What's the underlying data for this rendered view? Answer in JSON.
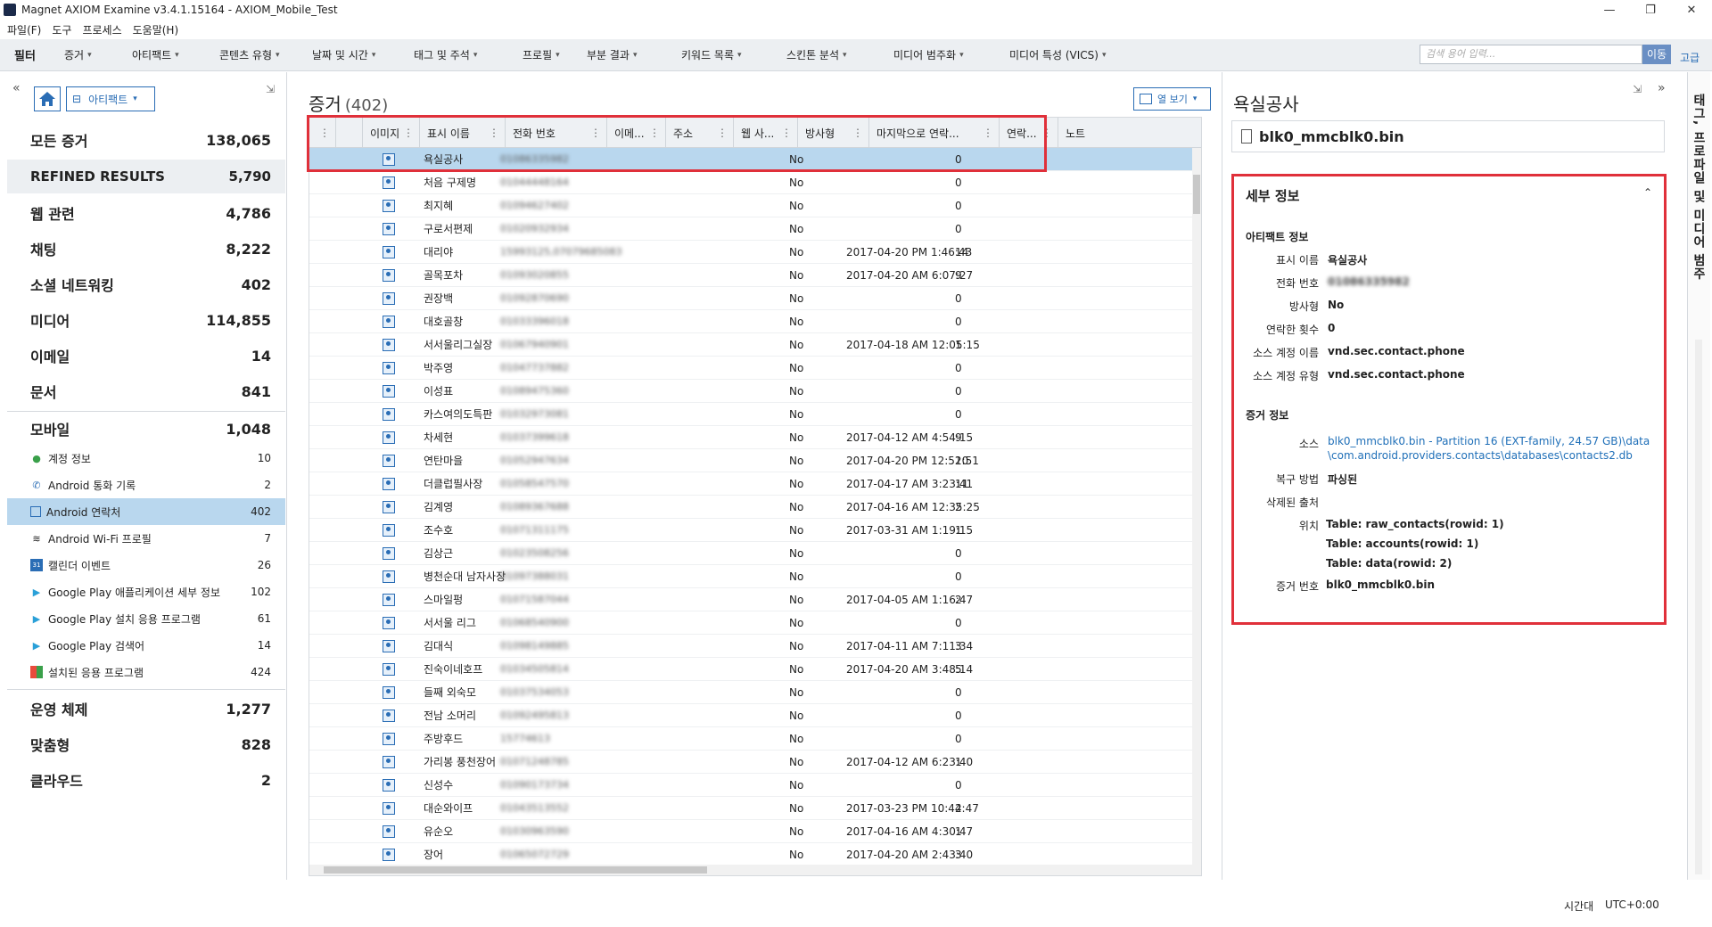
{
  "window": {
    "title": "Magnet AXIOM Examine v3.4.1.15164 - AXIOM_Mobile_Test",
    "controls": [
      "—",
      "❐",
      "✕"
    ]
  },
  "menu": [
    "파일(F)",
    "도구",
    "프로세스",
    "도움말(H)"
  ],
  "filterbar": {
    "label": "필터",
    "items": [
      "증거",
      "아티팩트",
      "콘텐츠 유형",
      "날짜 및 시간",
      "태그 및 주석",
      "프로필",
      "부분 결과",
      "키워드 목록",
      "스킨톤 분석",
      "미디어 범주화",
      "미디어 특성 (VICS)"
    ],
    "search_placeholder": "검색 용어 입력...",
    "search_button": "이동",
    "advanced": "고급"
  },
  "left": {
    "view_dropdown": "아티팩트",
    "categories": [
      {
        "label": "모든 증거",
        "count": "138,065"
      },
      {
        "label": "REFINED RESULTS",
        "count": "5,790"
      },
      {
        "label": "웹 관련",
        "count": "4,786"
      },
      {
        "label": "채팅",
        "count": "8,222"
      },
      {
        "label": "소셜 네트워킹",
        "count": "402"
      },
      {
        "label": "미디어",
        "count": "114,855"
      },
      {
        "label": "이메일",
        "count": "14"
      },
      {
        "label": "문서",
        "count": "841"
      },
      {
        "label": "모바일",
        "count": "1,048"
      }
    ],
    "mobile_items": [
      {
        "label": "계정 정보",
        "count": "10",
        "icon": "account-icon"
      },
      {
        "label": "Android 통화 기록",
        "count": "2",
        "icon": "phone-icon"
      },
      {
        "label": "Android 연락처",
        "count": "402",
        "icon": "contact-icon"
      },
      {
        "label": "Android Wi-Fi 프로필",
        "count": "7",
        "icon": "wifi-icon"
      },
      {
        "label": "캘린더 이벤트",
        "count": "26",
        "icon": "calendar-icon"
      },
      {
        "label": "Google Play 애플리케이션 세부 정보",
        "count": "102",
        "icon": "play-icon"
      },
      {
        "label": "Google Play 설치 응용 프로그램",
        "count": "61",
        "icon": "play-icon"
      },
      {
        "label": "Google Play 검색어",
        "count": "14",
        "icon": "play-icon"
      },
      {
        "label": "설치된 응용 프로그램",
        "count": "424",
        "icon": "apps-icon"
      }
    ],
    "bottom_categories": [
      {
        "label": "운영 체제",
        "count": "1,277"
      },
      {
        "label": "맞춤형",
        "count": "828"
      },
      {
        "label": "클라우드",
        "count": "2"
      }
    ]
  },
  "grid": {
    "title": "증거",
    "count": "(402)",
    "column_view": "열 보기",
    "headers": [
      "이미지",
      "표시 이름",
      "전화 번호",
      "이메...",
      "주소",
      "웹 사...",
      "방사형",
      "마지막으로 연락...",
      "연락...",
      "노트"
    ],
    "rows": [
      {
        "name": "욕실공사",
        "phone": "01086335982",
        "radial": "No",
        "last": "",
        "cnt": "0"
      },
      {
        "name": "처음 구제명",
        "phone": "01044448164",
        "radial": "No",
        "last": "",
        "cnt": "0"
      },
      {
        "name": "최지혜",
        "phone": "01094627402",
        "radial": "No",
        "last": "",
        "cnt": "0"
      },
      {
        "name": "구로서편제",
        "phone": "01020932934",
        "radial": "No",
        "last": "",
        "cnt": "0"
      },
      {
        "name": "대리야",
        "phone": "15993125,07079685083",
        "radial": "No",
        "last": "2017-04-20 PM 1:46:43",
        "cnt": "14"
      },
      {
        "name": "골목포차",
        "phone": "01093020855",
        "radial": "No",
        "last": "2017-04-20 AM 6:07:27",
        "cnt": "9"
      },
      {
        "name": "권장백",
        "phone": "01092870690",
        "radial": "No",
        "last": "",
        "cnt": "0"
      },
      {
        "name": "대호골창",
        "phone": "01033396018",
        "radial": "No",
        "last": "",
        "cnt": "0"
      },
      {
        "name": "서서울리그실장",
        "phone": "01067940901",
        "radial": "No",
        "last": "2017-04-18 AM 12:05:15",
        "cnt": "1"
      },
      {
        "name": "박주영",
        "phone": "01047737882",
        "radial": "No",
        "last": "",
        "cnt": "0"
      },
      {
        "name": "이성표",
        "phone": "01089475360",
        "radial": "No",
        "last": "",
        "cnt": "0"
      },
      {
        "name": "카스여의도특판",
        "phone": "01032973081",
        "radial": "No",
        "last": "",
        "cnt": "0"
      },
      {
        "name": "차세현",
        "phone": "01037399618",
        "radial": "No",
        "last": "2017-04-12 AM 4:54:15",
        "cnt": "9"
      },
      {
        "name": "연탄마을",
        "phone": "01052947634",
        "radial": "No",
        "last": "2017-04-20 PM 12:52:51",
        "cnt": "10"
      },
      {
        "name": "더클럽필사장",
        "phone": "01058547570",
        "radial": "No",
        "last": "2017-04-17 AM 3:23:41",
        "cnt": "11"
      },
      {
        "name": "김계영",
        "phone": "01089367688",
        "radial": "No",
        "last": "2017-04-16 AM 12:35:25",
        "cnt": "2"
      },
      {
        "name": "조수호",
        "phone": "01071311175",
        "radial": "No",
        "last": "2017-03-31 AM 1:19:15",
        "cnt": "1"
      },
      {
        "name": "김상근",
        "phone": "01023508256",
        "radial": "No",
        "last": "",
        "cnt": "0"
      },
      {
        "name": "병천순대 남자사장",
        "phone": "01097388031",
        "radial": "No",
        "last": "",
        "cnt": "0"
      },
      {
        "name": "스마일펑",
        "phone": "01071587044",
        "radial": "No",
        "last": "2017-04-05 AM 1:16:47",
        "cnt": "2"
      },
      {
        "name": "서서울 리그",
        "phone": "01068540900",
        "radial": "No",
        "last": "",
        "cnt": "0"
      },
      {
        "name": "김대식",
        "phone": "01098149885",
        "radial": "No",
        "last": "2017-04-11 AM 7:11:34",
        "cnt": "3"
      },
      {
        "name": "진숙이네호프",
        "phone": "01034505814",
        "radial": "No",
        "last": "2017-04-20 AM 3:48:14",
        "cnt": "5"
      },
      {
        "name": "들째 외숙모",
        "phone": "01037534053",
        "radial": "No",
        "last": "",
        "cnt": "0"
      },
      {
        "name": "전남 소머리",
        "phone": "01092495813",
        "radial": "No",
        "last": "",
        "cnt": "0"
      },
      {
        "name": "주방후드",
        "phone": "15774613",
        "radial": "No",
        "last": "",
        "cnt": "0"
      },
      {
        "name": "가리봉 풍천장어",
        "phone": "01071248785",
        "radial": "No",
        "last": "2017-04-12 AM 6:23:40",
        "cnt": "1"
      },
      {
        "name": "신성수",
        "phone": "01090173734",
        "radial": "No",
        "last": "",
        "cnt": "0"
      },
      {
        "name": "대순와이프",
        "phone": "01043513552",
        "radial": "No",
        "last": "2017-03-23 PM 10:44:47",
        "cnt": "2"
      },
      {
        "name": "유순오",
        "phone": "01030963590",
        "radial": "No",
        "last": "2017-04-16 AM 4:30:47",
        "cnt": "1"
      },
      {
        "name": "장어",
        "phone": "01065072729",
        "radial": "No",
        "last": "2017-04-20 AM 2:43:40",
        "cnt": "3"
      }
    ]
  },
  "right": {
    "title": "욕실공사",
    "file": "blk0_mmcblk0.bin",
    "details_title": "세부 정보",
    "artifact_section": "아티팩트 정보",
    "artifact": [
      {
        "k": "표시 이름",
        "v": "욕실공사"
      },
      {
        "k": "전화 번호",
        "v": "01086335982"
      },
      {
        "k": "방사형",
        "v": "No"
      },
      {
        "k": "연락한 횟수",
        "v": "0"
      },
      {
        "k": "소스 계정 이름",
        "v": "vnd.sec.contact.phone"
      },
      {
        "k": "소스 계정 유형",
        "v": "vnd.sec.contact.phone"
      }
    ],
    "evidence_section": "증거 정보",
    "source_k": "소스",
    "source_v1": "blk0_mmcblk0.bin - Partition 16 (EXT-family, 24.57 GB)\\data",
    "source_v2": "\\com.android.providers.contacts\\databases\\contacts2.db",
    "recovery_k": "복구 방법",
    "recovery_v": "파싱된",
    "deleted_k": "삭제된 출처",
    "location_k": "위치",
    "location_v": [
      "Table: raw_contacts(rowid: 1)",
      "Table: accounts(rowid: 1)",
      "Table: data(rowid: 2)"
    ],
    "evidence_no_k": "증거 번호",
    "evidence_no_v": "blk0_mmcblk0.bin"
  },
  "sidetab": "태그, 프로파일 및 미디어 범주",
  "status": {
    "tz_label": "시간대",
    "tz_value": "UTC+0:00"
  },
  "colors": {
    "accent": "#2a6db5",
    "selection": "#b9d7ee",
    "highlight": "#e0303a"
  }
}
